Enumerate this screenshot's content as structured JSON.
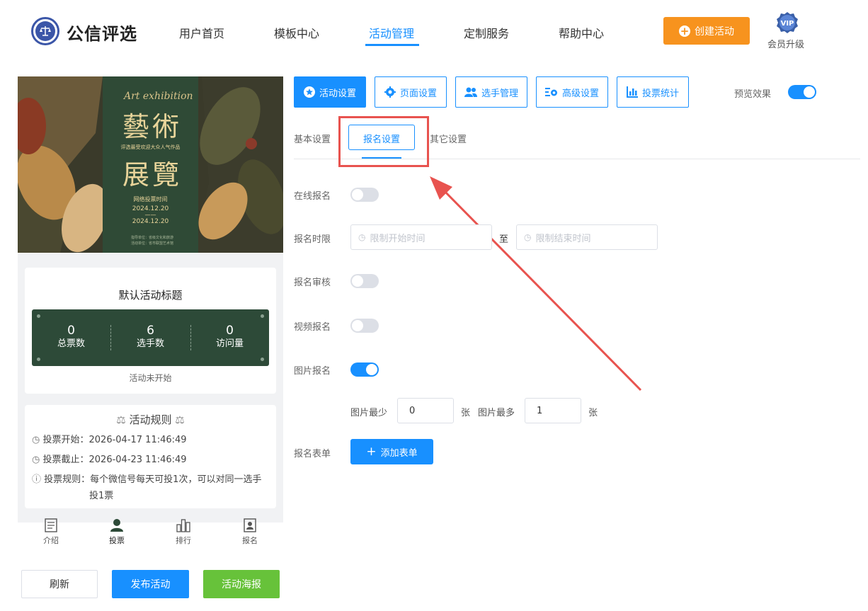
{
  "header": {
    "brand": "公信评选",
    "nav": [
      "用户首页",
      "模板中心",
      "活动管理",
      "定制服务",
      "帮助中心"
    ],
    "create_button": "创建活动",
    "vip_badge": "VIP",
    "vip_label": "会员升级"
  },
  "poster": {
    "script_title": "Art exhibition",
    "title_line1": "藝術",
    "subtitle": "评选最受欢迎大众人气作品",
    "title_line2": "展覽",
    "vote_time_label": "网络投票时间",
    "date_start": "2024.12.20",
    "date_sep": "——",
    "date_end": "2024.12.20",
    "note_line1": "指导单位：省级文化和旅游",
    "note_line2": "活动单位：省市联盟艺术馆"
  },
  "activity": {
    "title": "默认活动标题",
    "stats": [
      {
        "value": "0",
        "label": "总票数"
      },
      {
        "value": "6",
        "label": "选手数"
      },
      {
        "value": "0",
        "label": "访问量"
      }
    ],
    "status": "活动未开始"
  },
  "rules": {
    "heading": "活动规则",
    "start_label": "投票开始：",
    "start_value": "2026-04-17 11:46:49",
    "end_label": "投票截止：",
    "end_value": "2026-04-23 11:46:49",
    "rule_label": "投票规则：",
    "rule_text_1": "每个微信号每天可投1次，可以对同一选手",
    "rule_text_2": "投1票"
  },
  "bottom_nav": [
    "介绍",
    "投票",
    "排行",
    "报名"
  ],
  "left_buttons": {
    "refresh": "刷新",
    "publish": "发布活动",
    "poster": "活动海报"
  },
  "tabs": [
    "活动设置",
    "页面设置",
    "选手管理",
    "高级设置",
    "投票统计"
  ],
  "preview": {
    "label": "预览效果",
    "on": true
  },
  "subtabs": [
    "基本设置",
    "报名设置",
    "其它设置"
  ],
  "form": {
    "online_signup": {
      "label": "在线报名",
      "on": false
    },
    "signup_time": {
      "label": "报名时限",
      "start_placeholder": "限制开始时间",
      "separator": "至",
      "end_placeholder": "限制结束时间"
    },
    "signup_review": {
      "label": "报名审核",
      "on": false
    },
    "video_signup": {
      "label": "视频报名",
      "on": false
    },
    "image_signup": {
      "label": "图片报名",
      "on": true
    },
    "image_limits": {
      "min_label": "图片最少",
      "min_value": "0",
      "min_unit": "张",
      "max_label": "图片最多",
      "max_value": "1",
      "max_unit": "张"
    },
    "signup_form": {
      "label": "报名表单",
      "button": "添加表单"
    }
  },
  "colors": {
    "primary": "#1890ff",
    "orange": "#f7931e",
    "green": "#67c23a",
    "highlight": "#e8534f",
    "stat_bg": "#2d4a38"
  }
}
